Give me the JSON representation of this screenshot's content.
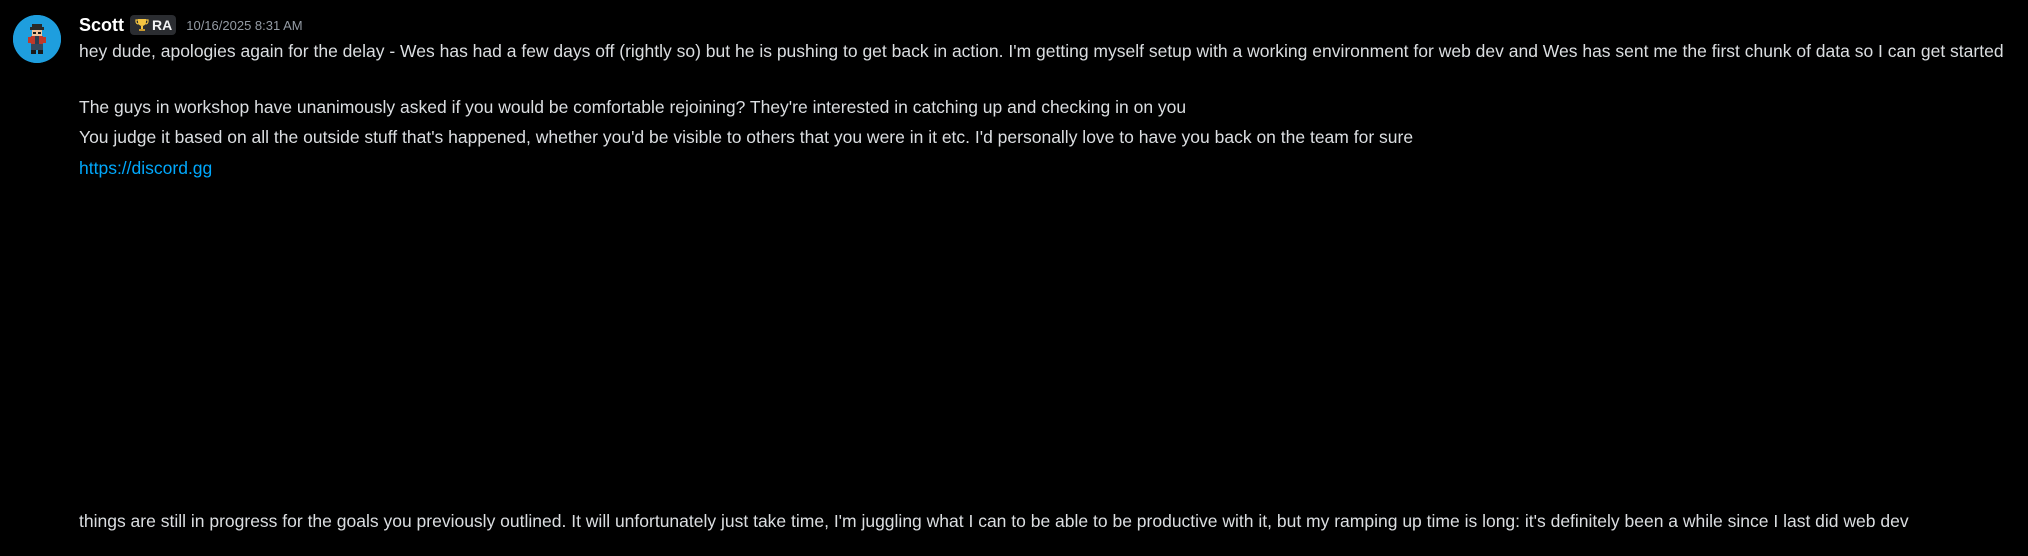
{
  "message": {
    "author": "Scott",
    "role_badge": {
      "icon": "trophy-icon",
      "label": "RA"
    },
    "timestamp": "10/16/2025 8:31 AM",
    "lines": [
      "hey dude, apologies again for the delay - Wes has had a few days off (rightly so) but he is pushing to get back in action. I'm getting myself setup with a working environment for web dev and Wes has sent me the first chunk of data so I can get started",
      "The guys in workshop have unanimously asked if you would be comfortable rejoining? They're interested in catching up and checking in on you",
      "You judge it based on all the outside stuff that's happened, whether you'd be visible to others that you were in it etc. I'd personally love to have you back on the team for sure",
      "things are still in progress for the goals you previously outlined. It will unfortunately just take time, I'm juggling what I can to be able to be productive with it, but my ramping up time is long: it's definitely been a while since I last did web dev"
    ],
    "link": "https://discord.gg"
  },
  "colors": {
    "background": "#000000",
    "text": "#dbdee1",
    "username": "#ffffff",
    "timestamp": "#949ba4",
    "link": "#00a8fc",
    "avatar_bg": "#1e9ede"
  }
}
